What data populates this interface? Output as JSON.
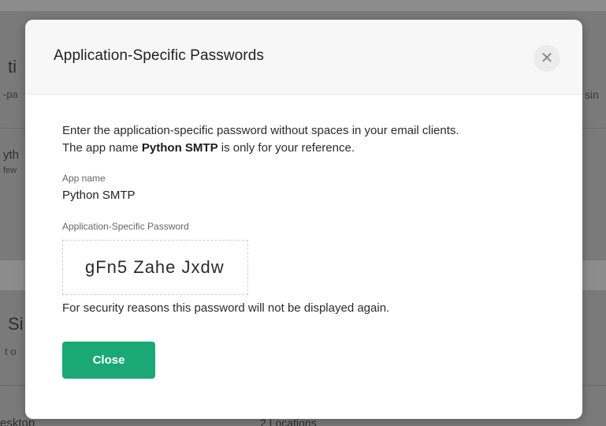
{
  "background": {
    "section1_title_fragment": "ti",
    "section1_sub_fragment": "-pa",
    "section1_right_fragment": "sin",
    "item_title_fragment": "yth",
    "item_sub_fragment": "few",
    "section2_title_fragment": "Si",
    "section2_sub_fragment": "t o",
    "row_left_fragment": "esktop",
    "row_right_fragment": "2 Locations"
  },
  "modal": {
    "title": "Application-Specific Passwords",
    "close_icon": "close-icon",
    "description_line1": "Enter the application-specific password without spaces in your email clients.",
    "description_line2_prefix": "The app name ",
    "description_app_name": "Python SMTP",
    "description_line2_suffix": " is only for your reference.",
    "app_name_label": "App name",
    "app_name_value": "Python SMTP",
    "password_label": "Application-Specific Password",
    "password_value": "gFn5 Zahe Jxdw",
    "security_note": "For security reasons this password will not be displayed again.",
    "close_button_label": "Close"
  },
  "colors": {
    "primary_button": "#1aa877",
    "overlay": "#7a7a7a"
  }
}
